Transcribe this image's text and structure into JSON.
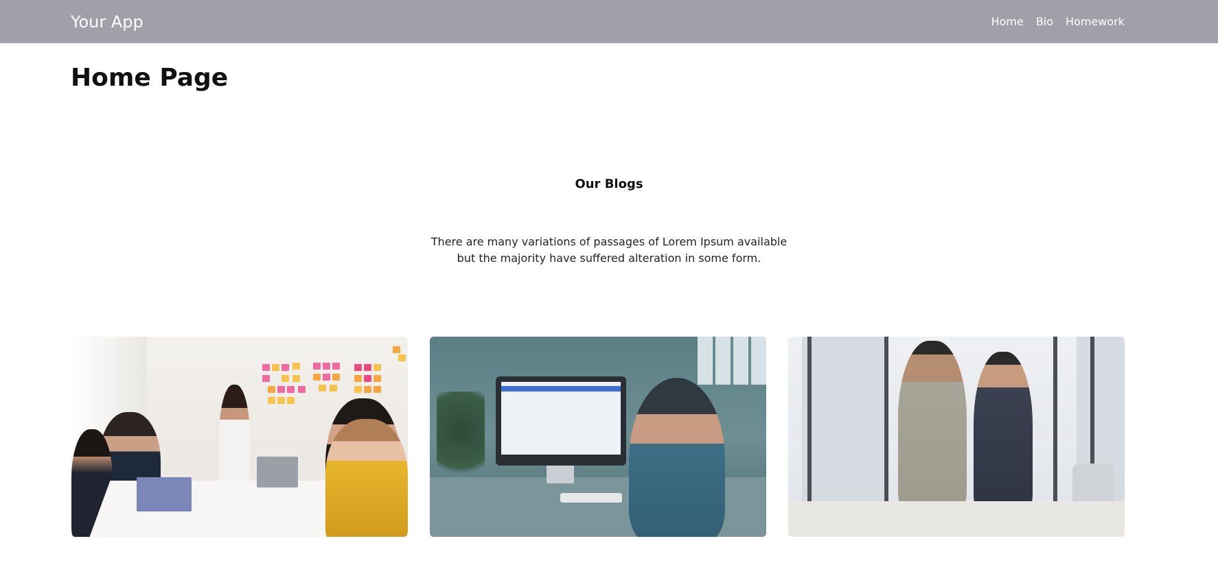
{
  "navbar": {
    "brand": "Your App",
    "links": [
      "Home",
      "Bio",
      "Homework"
    ]
  },
  "page_title": "Home Page",
  "blogs": {
    "heading": "Our Blogs",
    "description": "There are many variations of passages of Lorem Ipsum available but the majority have suffered alteration in some form."
  },
  "colors": {
    "navbar_bg": "#9fa0a9",
    "nav_text": "#ffffff"
  }
}
